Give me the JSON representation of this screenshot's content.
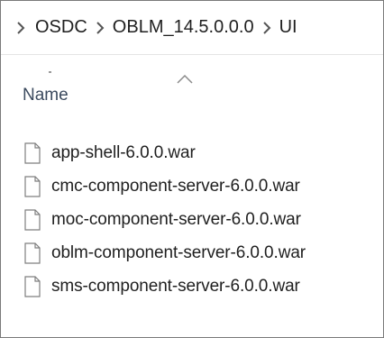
{
  "breadcrumb": {
    "items": [
      {
        "label": "OSDC"
      },
      {
        "label": "OBLM_14.5.0.0.0"
      },
      {
        "label": "UI"
      }
    ]
  },
  "header": {
    "name_column_label": "Name",
    "sort_icon": "chevron-up-icon"
  },
  "files": [
    {
      "name": "app-shell-6.0.0.war",
      "icon": "file-icon"
    },
    {
      "name": "cmc-component-server-6.0.0.war",
      "icon": "file-icon"
    },
    {
      "name": "moc-component-server-6.0.0.war",
      "icon": "file-icon"
    },
    {
      "name": "oblm-component-server-6.0.0.war",
      "icon": "file-icon"
    },
    {
      "name": "sms-component-server-6.0.0.war",
      "icon": "file-icon"
    }
  ]
}
